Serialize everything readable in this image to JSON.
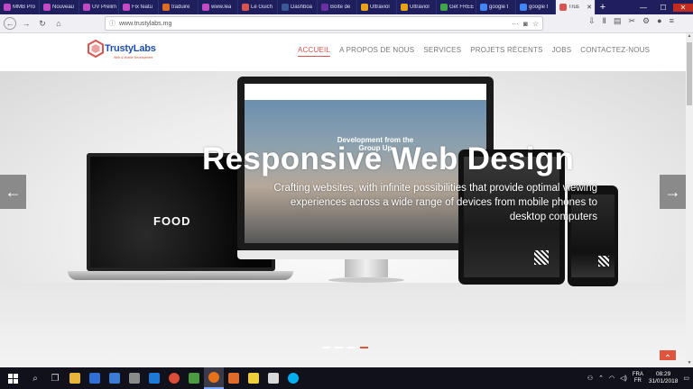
{
  "tabs": [
    {
      "label": "MMB Pro",
      "color": "#c04ac6"
    },
    {
      "label": "Nouveau",
      "color": "#c04ac6"
    },
    {
      "label": "UV Prelim",
      "color": "#c04ac6"
    },
    {
      "label": "Fix featu",
      "color": "#c04ac6"
    },
    {
      "label": "traduire",
      "color": "#e06b1f"
    },
    {
      "label": "www.lea",
      "color": "#c04ac6"
    },
    {
      "label": "Le Guich",
      "color": "#d9534f"
    },
    {
      "label": "Dashboa",
      "color": "#3b5998"
    },
    {
      "label": "Boîte de",
      "color": "#6b2fa3"
    },
    {
      "label": "Ultraviol",
      "color": "#e8a21a"
    },
    {
      "label": "Ultraviol",
      "color": "#e8a21a"
    },
    {
      "label": "Get FREE",
      "color": "#3fa34d"
    },
    {
      "label": "google t",
      "color": "#4285f4"
    },
    {
      "label": "google t",
      "color": "#4285f4"
    },
    {
      "label": "Trus",
      "color": "#d9534f",
      "active": true
    }
  ],
  "browser": {
    "url": "www.trustylabs.mg",
    "url_info": "ⓘ"
  },
  "site": {
    "logo_name": "TrustyLabs",
    "logo_tagline": "Web & Mobile Development",
    "menu": [
      "ACCUEIL",
      "A PROPOS DE NOUS",
      "SERVICES",
      "PROJETS RÉCENTS",
      "JOBS",
      "CONTACTEZ-NOUS"
    ],
    "accent_color": "#d9534f"
  },
  "hero": {
    "title": "Responsive Web Design",
    "subtitle": "Crafting websites, with infinite possibilities that provide optimal viewing experiences across a wide range of devices from mobile phones to desktop computers",
    "monitor_caption": "Development from the Group Up",
    "laptop_caption": "FOOD",
    "slides_total": 4,
    "slide_active": 4
  },
  "taskbar": {
    "lang_top": "FRA",
    "lang_bottom": "FR",
    "time": "08:29",
    "date": "31/01/2018"
  }
}
